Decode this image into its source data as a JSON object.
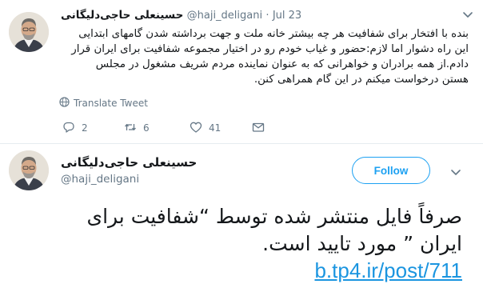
{
  "tweet": {
    "author_name": "حسینعلی حاجی‌دلیگانی",
    "handle": "@haji_deligani",
    "separator": "·",
    "date": "Jul 23",
    "body_lines": [
      "بنده با افتخار برای شفافیت هر چه بیشتر خانه ملت و جهت برداشته شدن گامهای ابتدایی",
      "این راه دشوار اما لازم:حضور و غیاب خودم رو در اختیار مجموعه شفافیت برای ایران قرار",
      "دادم.از همه برادران و خواهرانی که به عنوان نماینده مردم شریف مشغول در مجلس",
      "هستن درخواست میکنم در این گام همراهی کنن."
    ],
    "translate_label": "Translate Tweet",
    "reply_count": "2",
    "retweet_count": "6",
    "like_count": "41"
  },
  "focused_tweet": {
    "author_name": "حسینعلی حاجی‌دلیگانی",
    "handle": "@haji_deligani",
    "follow_label": "Follow",
    "body_lines": [
      "صرفاً فایل منتشر شده توسط “شفافیت برای",
      "ایران ” مورد تایید است."
    ],
    "link": "b.tp4.ir/post/711"
  },
  "colors": {
    "accent": "#1da1f2",
    "link": "#1b95e0",
    "secondary_text": "#657786",
    "primary_text": "#14171a",
    "divider": "#e6ecf0"
  },
  "icons": [
    "chevron-down-icon",
    "globe-icon",
    "reply-icon",
    "retweet-icon",
    "heart-icon",
    "message-icon",
    "avatar"
  ]
}
